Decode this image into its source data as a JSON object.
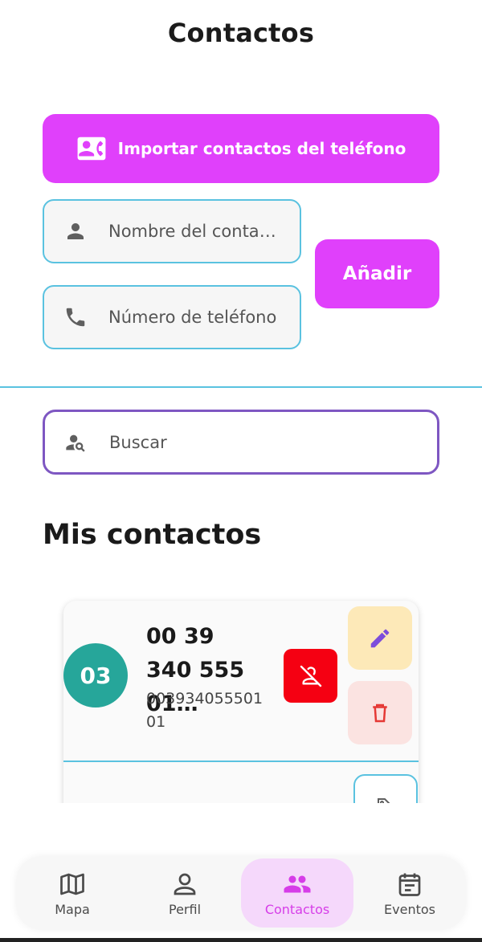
{
  "header": {
    "title": "Contactos"
  },
  "colors": {
    "primary": "#e040fb",
    "input_border": "#5ac2e0",
    "search_border": "#7e57c2",
    "divider": "#5ac2e0",
    "avatar": "#26a69a",
    "block": "#f50012",
    "edit_bg": "#fde9b8",
    "edit_icon": "#7c4ddb",
    "delete_bg": "#fbe3e1",
    "delete_icon": "#e53935",
    "icon_gray": "#5f5f5f",
    "nav_active_bg": "#f5d8fb",
    "nav_active_text": "#d63de8"
  },
  "import": {
    "label": "Importar contactos del teléfono",
    "icon": "contacts-card-icon"
  },
  "form": {
    "name_placeholder": "Nombre del contacto",
    "phone_placeholder": "Número de teléfono",
    "add_label": "Añadir"
  },
  "search": {
    "placeholder": "Buscar"
  },
  "section": {
    "title": "Mis contactos"
  },
  "contacts": [
    {
      "initials": "03",
      "name": "00 39 340 555 01…",
      "phone": "00393405550101"
    }
  ],
  "nav": {
    "items": [
      {
        "label": "Mapa",
        "icon": "map-icon",
        "active": false
      },
      {
        "label": "Perfil",
        "icon": "person-icon",
        "active": false
      },
      {
        "label": "Contactos",
        "icon": "group-icon",
        "active": true
      },
      {
        "label": "Eventos",
        "icon": "calendar-icon",
        "active": false
      }
    ]
  }
}
